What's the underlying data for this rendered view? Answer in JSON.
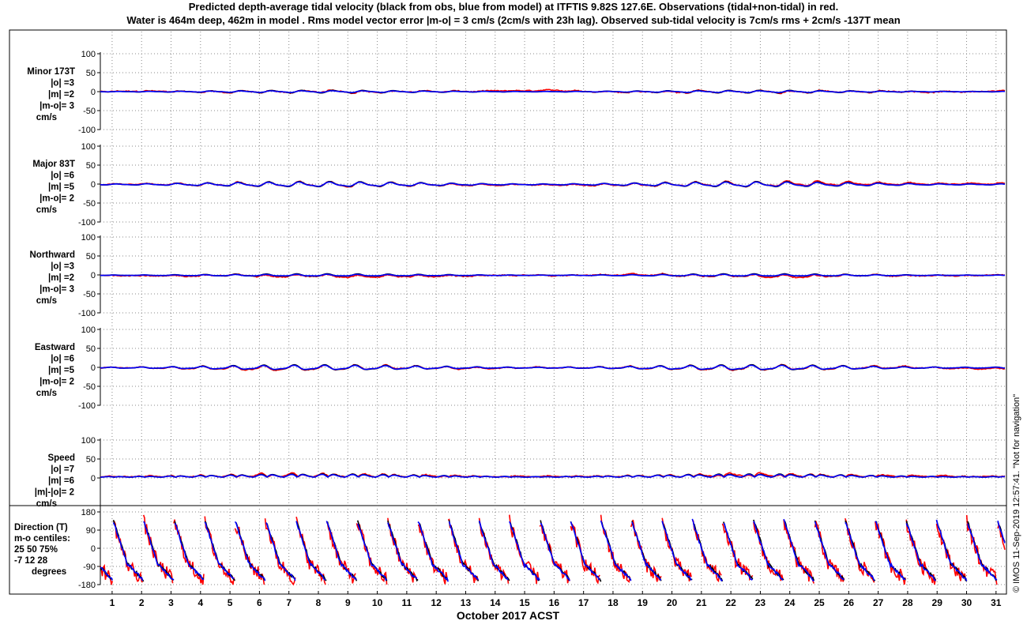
{
  "title": {
    "line1": "Predicted depth-average tidal velocity (black from obs, blue from model) at ITFTIS 9.82S 127.6E. Observations (tidal+non-tidal) in red.",
    "line2": "Water is 464m deep, 462m in model . Rms model vector error |m-o| = 3 cm/s (2cm/s with 23h lag). Observed sub-tidal velocity is 7cm/s rms + 2cm/s -137T mean"
  },
  "xlabel": "October 2017 ACST",
  "credit": "© IMOS 11-Sep-2019 12:57:41. \"Not for navigation\"",
  "colors": {
    "observed_tidal": "#000000",
    "model": "#0000ff",
    "observations": "#ff0000"
  },
  "chart_data": {
    "type": "line",
    "x_unit": "day of October 2017",
    "x_ticks": [
      "1",
      "2",
      "3",
      "4",
      "5",
      "6",
      "7",
      "8",
      "9",
      "10",
      "11",
      "12",
      "13",
      "14",
      "15",
      "16",
      "17",
      "18",
      "19",
      "20",
      "21",
      "22",
      "23",
      "24",
      "25",
      "26",
      "27",
      "28",
      "29",
      "30",
      "31"
    ],
    "xlim": [
      0.6,
      31.3
    ],
    "grid": true,
    "series_legend": [
      {
        "name": "black from obs",
        "color": "#000000"
      },
      {
        "name": "blue from model",
        "color": "#0000ff"
      },
      {
        "name": "Observations (tidal+non-tidal)",
        "color": "#ff0000"
      }
    ],
    "panels": [
      {
        "key": "minor",
        "label_lines": [
          "Minor 173T",
          "|o| =3",
          "|m| =2",
          "|m-o|= 3",
          "cm/s"
        ],
        "ylim": [
          -100,
          100
        ],
        "y_ticks": [
          "100",
          "50",
          "0",
          "-50",
          "-100"
        ],
        "show_min_tick": true,
        "obs_amp": 3,
        "model_amp": 2,
        "raw_amp": 5,
        "noise": 4,
        "bias": 0
      },
      {
        "key": "major",
        "label_lines": [
          "Major 83T",
          "|o| =6",
          "|m| =5",
          "|m-o|= 2",
          "cm/s"
        ],
        "ylim": [
          -100,
          100
        ],
        "y_ticks": [
          "100",
          "50",
          "0",
          "-50",
          "-100"
        ],
        "show_min_tick": false,
        "obs_amp": 6,
        "model_amp": 5,
        "raw_amp": 8,
        "noise": 3,
        "bias": -1
      },
      {
        "key": "northward",
        "label_lines": [
          "Northward",
          "|o| =3",
          "|m| =2",
          "|m-o|= 3",
          "cm/s"
        ],
        "ylim": [
          -100,
          100
        ],
        "y_ticks": [
          "100",
          "50",
          "0",
          "-50",
          "-100"
        ],
        "show_min_tick": true,
        "obs_amp": 3,
        "model_amp": 2,
        "raw_amp": 5,
        "noise": 4,
        "bias": -1
      },
      {
        "key": "eastward",
        "label_lines": [
          "Eastward",
          "|o| =6",
          "|m| =5",
          "|m-o|= 2",
          "cm/s"
        ],
        "ylim": [
          -100,
          100
        ],
        "y_ticks": [
          "100",
          "50",
          "0",
          "-50",
          "-100"
        ],
        "show_min_tick": true,
        "obs_amp": 6,
        "model_amp": 5,
        "raw_amp": 8,
        "noise": 3,
        "bias": -1
      },
      {
        "key": "speed",
        "label_lines": [
          "Speed",
          "|o| =7",
          "|m| =6",
          "|m|-|o|= 2",
          "cm/s"
        ],
        "ylim": [
          -100,
          100
        ],
        "y_ticks": [
          "100",
          "50",
          "0"
        ],
        "show_min_tick": false,
        "speed": true,
        "obs_amp": 7,
        "model_amp": 6,
        "raw_amp": 9,
        "noise": 4,
        "bias": 0
      }
    ],
    "direction_panel": {
      "label_lines": [
        "Direction (T)",
        "m-o centiles:",
        "25  50  75%",
        "-7  12  28",
        "degrees"
      ],
      "ylim": [
        -180,
        180
      ],
      "y_ticks": [
        "180",
        "90",
        "0",
        "-90",
        "-180"
      ]
    }
  }
}
